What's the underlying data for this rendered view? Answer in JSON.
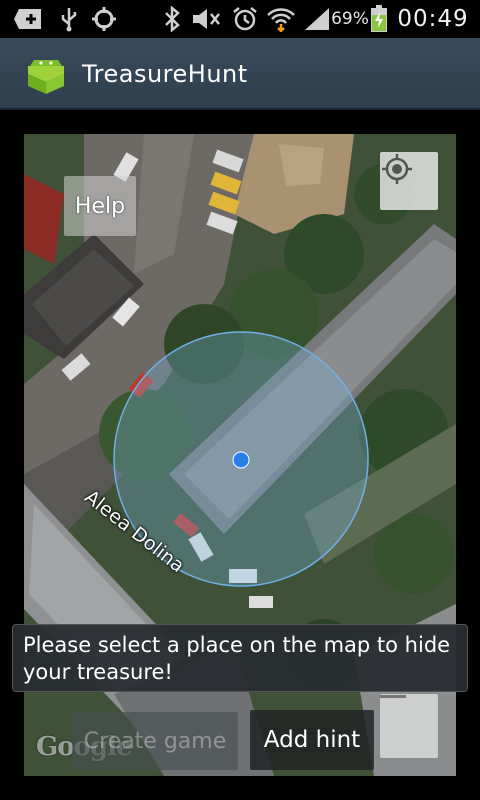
{
  "status_bar": {
    "battery_percent": "69%",
    "time": "00:49",
    "icons": [
      "add-box-icon",
      "usb-icon",
      "gps-icon",
      "bluetooth-icon",
      "mute-icon",
      "alarm-icon",
      "wifi-icon",
      "signal-icon",
      "battery-icon"
    ]
  },
  "action_bar": {
    "title": "TreasureHunt",
    "icon": "android-icon"
  },
  "map": {
    "help_label": "Help",
    "street_label": "Aleea Dolina",
    "create_game_label": "Create game",
    "add_hint_label": "Add hint",
    "google_label": "Google",
    "locate_icon": "my-location-icon",
    "zoom_out_icon": "minus-icon"
  },
  "toast": {
    "message": "Please select a place on the map to hide your treasure!"
  },
  "colors": {
    "action_bar": "#33475a",
    "accent_location": "#2a7fe8",
    "circle_fill": "#7ab4e0"
  }
}
